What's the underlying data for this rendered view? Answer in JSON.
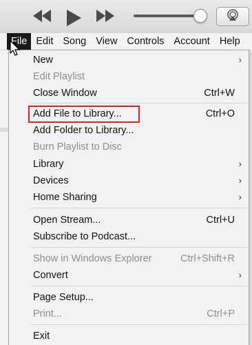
{
  "colors": {
    "highlight_border": "#e0202a",
    "menu_bg": "#f2f2f2",
    "active_menu_bg": "#1a1a1a",
    "disabled_text": "#8e8e8e"
  },
  "player": {
    "prev_icon": "rewind-icon",
    "play_icon": "play-icon",
    "next_icon": "fast-forward-icon",
    "volume_level": 0.95,
    "airplay_icon": "airplay-icon"
  },
  "menubar": {
    "items": [
      {
        "label": "File",
        "active": true
      },
      {
        "label": "Edit"
      },
      {
        "label": "Song"
      },
      {
        "label": "View"
      },
      {
        "label": "Controls"
      },
      {
        "label": "Account"
      },
      {
        "label": "Help"
      }
    ]
  },
  "file_menu": {
    "items": [
      {
        "label": "New",
        "shortcut": "",
        "submenu": true,
        "disabled": false
      },
      {
        "label": "Edit Playlist",
        "shortcut": "",
        "submenu": false,
        "disabled": true
      },
      {
        "label": "Close Window",
        "shortcut": "Ctrl+W",
        "submenu": false,
        "disabled": false
      },
      {
        "label": "Add File to Library...",
        "shortcut": "Ctrl+O",
        "submenu": false,
        "disabled": false,
        "highlighted": true
      },
      {
        "label": "Add Folder to Library...",
        "shortcut": "",
        "submenu": false,
        "disabled": false
      },
      {
        "label": "Burn Playlist to Disc",
        "shortcut": "",
        "submenu": false,
        "disabled": true
      },
      {
        "label": "Library",
        "shortcut": "",
        "submenu": true,
        "disabled": false
      },
      {
        "label": "Devices",
        "shortcut": "",
        "submenu": true,
        "disabled": false
      },
      {
        "label": "Home Sharing",
        "shortcut": "",
        "submenu": true,
        "disabled": false
      },
      {
        "label": "Open Stream...",
        "shortcut": "Ctrl+U",
        "submenu": false,
        "disabled": false
      },
      {
        "label": "Subscribe to Podcast...",
        "shortcut": "",
        "submenu": false,
        "disabled": false
      },
      {
        "label": "Show in Windows Explorer",
        "shortcut": "Ctrl+Shift+R",
        "submenu": false,
        "disabled": true
      },
      {
        "label": "Convert",
        "shortcut": "",
        "submenu": true,
        "disabled": false
      },
      {
        "label": "Page Setup...",
        "shortcut": "",
        "submenu": false,
        "disabled": false
      },
      {
        "label": "Print...",
        "shortcut": "Ctrl+P",
        "submenu": false,
        "disabled": true
      },
      {
        "label": "Exit",
        "shortcut": "",
        "submenu": false,
        "disabled": false
      }
    ]
  }
}
